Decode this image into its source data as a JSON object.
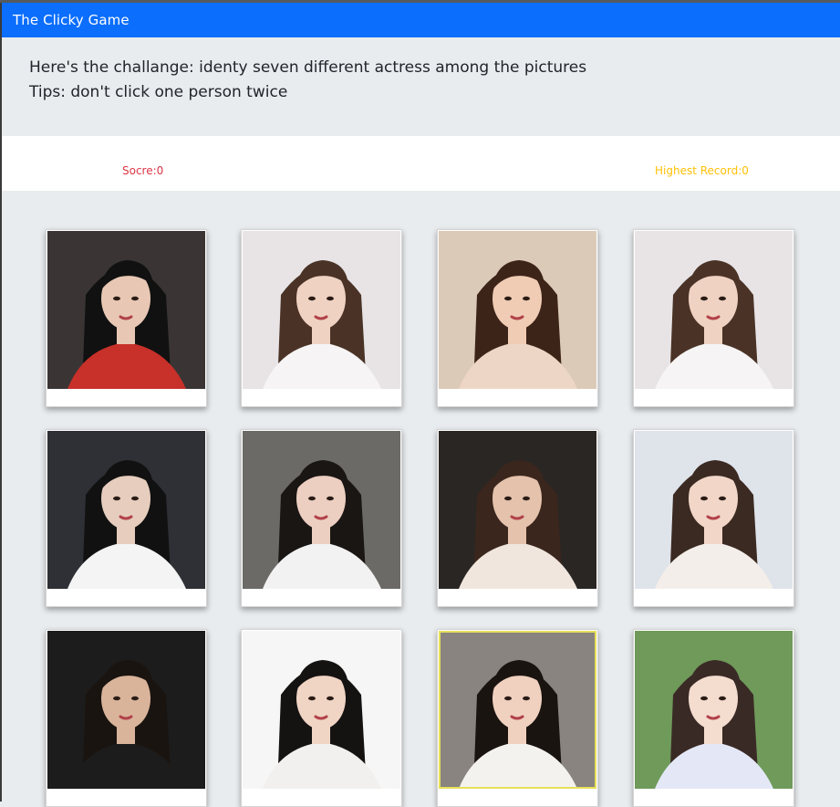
{
  "app": {
    "title": "The Clicky Game"
  },
  "jumbotron": {
    "challenge": "Here's the challange: identy seven different actress among the pictures",
    "tips": "Tips: don't click one person twice"
  },
  "scoreboard": {
    "score_label": "Socre:0",
    "record_label": "Highest Record:0"
  },
  "colors": {
    "navbar": "#0b6efd",
    "score": "#dc3545",
    "record": "#ffc107",
    "background": "#e9ecef"
  },
  "cards": [
    {
      "name": "portrait-1",
      "bg": "#3a3534",
      "hair": "#111111",
      "skin": "#e8c8b4",
      "outfit": "#c8302a"
    },
    {
      "name": "portrait-2",
      "bg": "#e8e4e6",
      "hair": "#4a3326",
      "skin": "#f0d2c2",
      "outfit": "#f6f4f4"
    },
    {
      "name": "portrait-3",
      "bg": "#dccab8",
      "hair": "#3d2418",
      "skin": "#f0ccb4",
      "outfit": "#eed6c6"
    },
    {
      "name": "portrait-4",
      "bg": "#e8e4e6",
      "hair": "#4a3326",
      "skin": "#f0d2c2",
      "outfit": "#f6f4f4"
    },
    {
      "name": "portrait-5",
      "bg": "#2e3036",
      "hair": "#111111",
      "skin": "#e6cdbd",
      "outfit": "#f4f4f4"
    },
    {
      "name": "portrait-6",
      "bg": "#6b6a66",
      "hair": "#1a1614",
      "skin": "#eccfc1",
      "outfit": "#f2f2f2"
    },
    {
      "name": "portrait-7",
      "bg": "#2a2624",
      "hair": "#3a261c",
      "skin": "#e4c2ac",
      "outfit": "#f0e6de"
    },
    {
      "name": "portrait-8",
      "bg": "#dfe3ea",
      "hair": "#3b2a22",
      "skin": "#f2d6c8",
      "outfit": "#f4eeea"
    },
    {
      "name": "portrait-9",
      "bg": "#1c1c1c",
      "hair": "#1a1410",
      "skin": "#d9b49a",
      "outfit": "#1c1c1c"
    },
    {
      "name": "portrait-10",
      "bg": "#f6f6f6",
      "hair": "#151212",
      "skin": "#f0d4c4",
      "outfit": "#f2f0ee"
    },
    {
      "name": "portrait-11",
      "bg": "#8a8480",
      "hair": "#1a1410",
      "skin": "#f0d0bf",
      "outfit": "#f4f2ee"
    },
    {
      "name": "portrait-12",
      "bg": "#6f9a5a",
      "hair": "#3a2a26",
      "skin": "#f4dccf",
      "outfit": "#e4e8f6"
    }
  ]
}
